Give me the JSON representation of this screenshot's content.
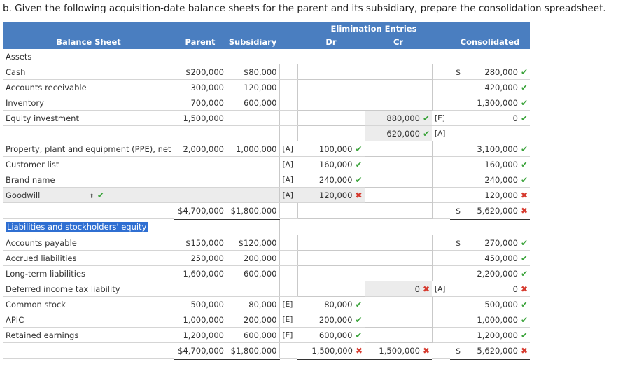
{
  "heading": "b. Given the following acquisition-date balance sheets for the parent and its subsidiary, prepare the consolidation spreadsheet.",
  "header": {
    "balance_sheet": "Balance Sheet",
    "parent": "Parent",
    "subsidiary": "Subsidiary",
    "elimination": "Elimination Entries",
    "dr": "Dr",
    "cr": "Cr",
    "consolidated": "Consolidated"
  },
  "assets_label": "Assets",
  "liab_label": "Liabilities and stockholders' equity",
  "dollar_sign": "$",
  "marks": {
    "ok": "✔",
    "bad": "✖",
    "updown": "⬍"
  },
  "rows": {
    "cash": {
      "label": "Cash",
      "parent": "$200,000",
      "sub": "$80,000",
      "cons": "280,000"
    },
    "ar": {
      "label": "Accounts receivable",
      "parent": "300,000",
      "sub": "120,000",
      "cons": "420,000"
    },
    "inv": {
      "label": "Inventory",
      "parent": "700,000",
      "sub": "600,000",
      "cons": "1,300,000"
    },
    "eqinv": {
      "label": "Equity investment",
      "parent": "1,500,000",
      "cr": "880,000",
      "cr_ref": "[E]",
      "cons": "0"
    },
    "eqinv2": {
      "cr": "620,000",
      "cr_ref": "[A]"
    },
    "ppe": {
      "label": "Property, plant and equipment (PPE), net",
      "parent": "2,000,000",
      "sub": "1,000,000",
      "sub_ref": "[A]",
      "dr": "100,000",
      "cons": "3,100,000"
    },
    "cust": {
      "label": "Customer list",
      "sub_ref": "[A]",
      "dr": "160,000",
      "cons": "160,000"
    },
    "brand": {
      "label": "Brand name",
      "sub_ref": "[A]",
      "dr": "240,000",
      "cons": "240,000"
    },
    "goodwill": {
      "label": "Goodwill",
      "sub_ref": "[A]",
      "dr": "120,000",
      "cons": "120,000"
    },
    "tot_assets": {
      "parent": "$4,700,000",
      "sub": "$1,800,000",
      "cons": "5,620,000"
    },
    "ap": {
      "label": "Accounts payable",
      "parent": "$150,000",
      "sub": "$120,000",
      "cons": "270,000"
    },
    "accr": {
      "label": "Accrued liabilities",
      "parent": "250,000",
      "sub": "200,000",
      "cons": "450,000"
    },
    "ltl": {
      "label": "Long-term liabilities",
      "parent": "1,600,000",
      "sub": "600,000",
      "cons": "2,200,000"
    },
    "dtl": {
      "label": "Deferred income tax liability",
      "cr": "0",
      "cr_ref": "[A]",
      "cons": "0"
    },
    "cs": {
      "label": "Common stock",
      "parent": "500,000",
      "sub": "80,000",
      "sub_ref": "[E]",
      "dr": "80,000",
      "cons": "500,000"
    },
    "apic": {
      "label": "APIC",
      "parent": "1,000,000",
      "sub": "200,000",
      "sub_ref": "[E]",
      "dr": "200,000",
      "cons": "1,000,000"
    },
    "re": {
      "label": "Retained earnings",
      "parent": "1,200,000",
      "sub": "600,000",
      "sub_ref": "[E]",
      "dr": "600,000",
      "cons": "1,200,000"
    },
    "tot_le": {
      "parent": "$4,700,000",
      "sub": "$1,800,000",
      "dr": "1,500,000",
      "cr": "1,500,000",
      "cons": "5,620,000"
    }
  }
}
